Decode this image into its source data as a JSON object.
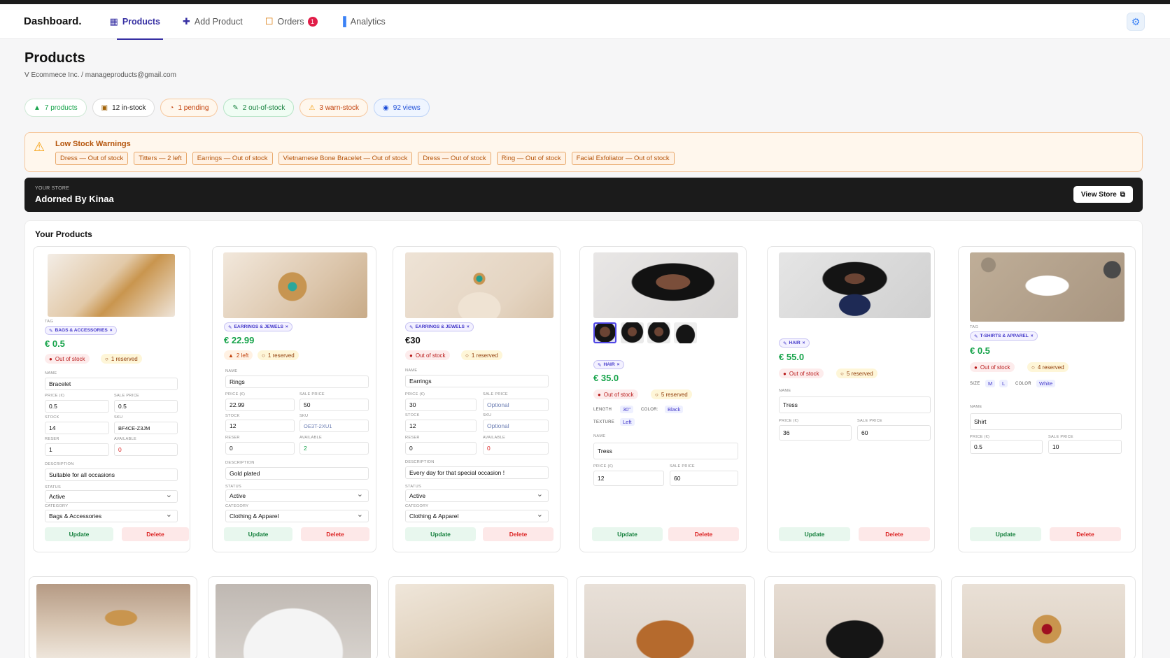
{
  "nav": {
    "brand": "Dashboard.",
    "items": [
      {
        "label": "Products",
        "icon": "▦"
      },
      {
        "label": "Add Product",
        "icon": "✚"
      },
      {
        "label": "Orders",
        "icon": "☐",
        "badge": "1"
      },
      {
        "label": "Analytics",
        "icon": "▐"
      }
    ],
    "settings_icon": "⚙"
  },
  "header": {
    "title": "Products",
    "subtitle": "V Ecommece Inc. / manageproducts@gmail.com"
  },
  "stats": [
    {
      "icon": "▲",
      "text": "7 products"
    },
    {
      "icon": "▣",
      "text": "12 in-stock"
    },
    {
      "icon": "◔",
      "text": "1 pending"
    },
    {
      "icon": "✎",
      "text": "2 out-of-stock"
    },
    {
      "icon": "⚠",
      "text": "3 warn-stock"
    },
    {
      "icon": "◉",
      "text": "92 views"
    }
  ],
  "warnings": {
    "icon": "⚠",
    "title": "Low Stock Warnings",
    "items": [
      "Dress — Out of stock",
      "Titters — 2 left",
      "Earrings — Out of stock",
      "Vietnamese Bone Bracelet — Out of stock",
      "Dress — Out of stock",
      "Ring — Out of stock",
      "Facial Exfoliator — Out of stock"
    ]
  },
  "store": {
    "label": "YOUR STORE",
    "name": "Adorned By Kinaa",
    "view_label": "View Store",
    "view_icon": "⧉"
  },
  "products_title": "Your Products",
  "labels": {
    "tag": "TAG",
    "name": "NAME",
    "price": "PRICE (€)",
    "sale": "SALE PRICE",
    "stock": "STOCK",
    "sku": "SKU",
    "reserved": "RESER",
    "available": "AVAILABLE",
    "description": "DESCRIPTION",
    "status": "STATUS",
    "category": "CATEGORY",
    "length": "LENGTH",
    "color": "COLOR:",
    "texture": "TEXTURE",
    "size": "SIZE",
    "color2": "COLOR",
    "update": "Update",
    "delete": "Delete",
    "close_x": "×",
    "tag_icon": "✎",
    "out_icon": "●",
    "warn_icon": "▲",
    "res_icon": "○"
  },
  "cards": [
    {
      "tag": "BAGS & ACCESSORIES",
      "price": "€ 0.5",
      "stock_status": "Out of stock",
      "reserved": "1 reserved",
      "name": "Bracelet",
      "price_val": "0.5",
      "sale_val": "0.5",
      "stock_val": "14",
      "sku_val": "BF4CE-Z3JM",
      "reserved_val": "1",
      "available_val": "0",
      "description": "Suitable for all occasions",
      "status": "Active",
      "category": "Bags & Accessories"
    },
    {
      "tag": "EARRINGS & JEWELS",
      "price": "€ 22.99",
      "stock_status": "2 left",
      "reserved": "1 reserved",
      "name": "Rings",
      "price_val": "22.99",
      "sale_val": "50",
      "stock_val": "12",
      "sku_val": "OE3T-2XU1",
      "reserved_val": "0",
      "available_val": "2",
      "description": "Gold plated",
      "status": "Active",
      "category": "Clothing & Apparel"
    },
    {
      "tag": "EARRINGS & JEWELS",
      "price": "€30",
      "stock_status": "Out of stock",
      "reserved": "1 reserved",
      "name": "Earrings",
      "price_val": "30",
      "sale_placeholder": "Optional",
      "stock_val": "12",
      "sku_placeholder": "Optional",
      "reserved_val": "0",
      "available_val": "0",
      "description": "Every day for that special occasion !",
      "status": "Active",
      "category": "Clothing & Apparel"
    },
    {
      "tag": "HAIR",
      "price": "€ 35.0",
      "stock_status": "Out of stock",
      "reserved": "5 reserved",
      "length": "30\"",
      "color": "Black",
      "texture": "Left",
      "name": "Tress",
      "price_val": "12",
      "sale_val": "60"
    },
    {
      "tag": "HAIR",
      "price": "€ 55.0",
      "stock_status": "Out of stock",
      "reserved": "5 reserved",
      "name": "Tress",
      "price_val": "36",
      "sale_val": "60"
    },
    {
      "tag": "T-SHIRTS & APPAREL",
      "price": "€ 0.5",
      "stock_status": "Out of stock",
      "reserved": "4 reserved",
      "size_m": "M",
      "size_l": "L",
      "color": "White",
      "name": "Shirt",
      "price_val": "0.5",
      "sale_val": "10"
    }
  ]
}
